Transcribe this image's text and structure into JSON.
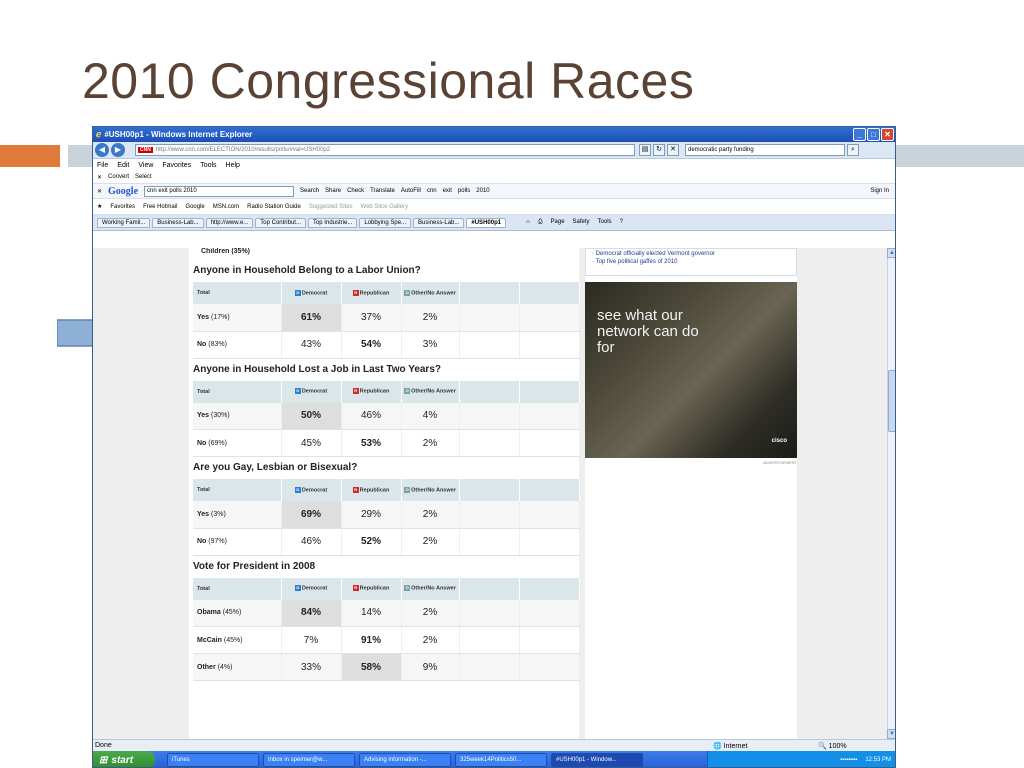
{
  "slide": {
    "title": "2010 Congressional Races",
    "colors": {
      "title": "#5a4234",
      "accent": "#e07a3a",
      "band": "#c9d3dc",
      "arrow": "#8fb0d6"
    }
  },
  "browser": {
    "title": "#USH00p1 - Windows Internet Explorer",
    "address": "http://www.cnn.com/ELECTION/2010/results/polls/#val=USH00p2",
    "search_value": "democratic party funding",
    "menu": [
      "File",
      "Edit",
      "View",
      "Favorites",
      "Tools",
      "Help"
    ],
    "convert_label": "Convert",
    "select_label": "Select",
    "google": {
      "logo": "Google",
      "query": "cnn exit polls 2010",
      "items": [
        "Search",
        "Share",
        "Check",
        "Translate",
        "AutoFill",
        "cnn",
        "exit",
        "polls",
        "2010",
        "Sign In"
      ]
    },
    "favorites": {
      "label": "Favorites",
      "items": [
        "Free Hotmail",
        "Google",
        "MSN.com",
        "Radio Station Guide",
        "Suggested Sites",
        "Web Slice Gallery"
      ]
    },
    "tabs": [
      "Working Famil...",
      "Business-Lab...",
      "http://www.e...",
      "Top Contribut...",
      "Top Industrie...",
      "Lobbying Spe...",
      "Business-Lab...",
      "#USH00p1"
    ],
    "commands": [
      "Page",
      "Safety",
      "Tools"
    ],
    "status": "Done",
    "zone": "Internet",
    "zoom": "100%"
  },
  "poll": {
    "carry_row": "Children (35%)",
    "headers": {
      "total": "Total",
      "dem": "Democrat",
      "rep": "Republican",
      "other": "Other/No Answer"
    },
    "sections": [
      {
        "question": "Anyone in Household Belong to a Labor Union?",
        "rows": [
          {
            "label": "Yes",
            "pct": "(17%)",
            "dem": "61%",
            "rep": "37%",
            "other": "2%",
            "hl": "dem"
          },
          {
            "label": "No",
            "pct": "(83%)",
            "dem": "43%",
            "rep": "54%",
            "other": "3%",
            "hl": "rep"
          }
        ]
      },
      {
        "question": "Anyone in Household Lost a Job in Last Two Years?",
        "rows": [
          {
            "label": "Yes",
            "pct": "(30%)",
            "dem": "50%",
            "rep": "46%",
            "other": "4%",
            "hl": "dem"
          },
          {
            "label": "No",
            "pct": "(69%)",
            "dem": "45%",
            "rep": "53%",
            "other": "2%",
            "hl": "rep"
          }
        ]
      },
      {
        "question": "Are you Gay, Lesbian or Bisexual?",
        "rows": [
          {
            "label": "Yes",
            "pct": "(3%)",
            "dem": "69%",
            "rep": "29%",
            "other": "2%",
            "hl": "dem"
          },
          {
            "label": "No",
            "pct": "(97%)",
            "dem": "46%",
            "rep": "52%",
            "other": "2%",
            "hl": "rep"
          }
        ]
      },
      {
        "question": "Vote for President in 2008",
        "rows": [
          {
            "label": "Obama",
            "pct": "(45%)",
            "dem": "84%",
            "rep": "14%",
            "other": "2%",
            "hl": "dem"
          },
          {
            "label": "McCain",
            "pct": "(45%)",
            "dem": "7%",
            "rep": "91%",
            "other": "2%",
            "hl": "rep"
          },
          {
            "label": "Other",
            "pct": "(4%)",
            "dem": "33%",
            "rep": "58%",
            "other": "9%",
            "hl": "rep"
          }
        ]
      }
    ]
  },
  "sidebar": {
    "news": [
      "Democrat officially elected Vermont governor",
      "Top five political gaffes of 2010"
    ],
    "ad_text": "see what our network can do for",
    "ad_brand": "cisco",
    "ad_label": "ADVERTISEMENT"
  },
  "taskbar": {
    "start": "start",
    "items": [
      "iTunes",
      "Inbox in speimer@w...",
      "Advising information -...",
      "325week14Politics50...",
      "#USH00p1 - Window..."
    ],
    "clock": "12:53 PM"
  }
}
